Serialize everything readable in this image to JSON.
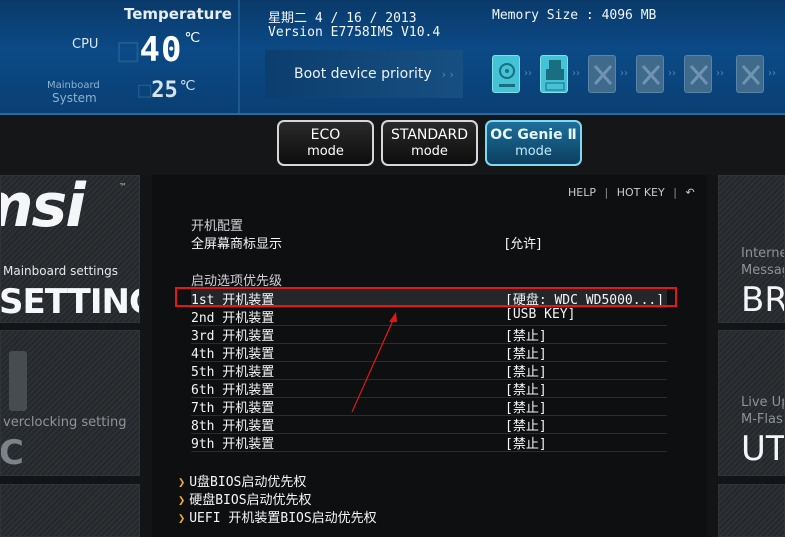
{
  "header": {
    "temperature_title": "Temperature",
    "cpu_label": "CPU",
    "cpu_temp": "40",
    "cpu_temp_ghost": "□",
    "mainboard_label_line1": "Mainboard",
    "mainboard_label_line2": "System",
    "system_temp": "25",
    "system_temp_ghost": "□",
    "degree_unit": "℃",
    "date_line": "星期二  4 / 16 / 2013",
    "version_line": "Version E7758IMS V10.4",
    "memory_line": "Memory Size : 4096 MB",
    "boot_priority_label": "Boot device priority",
    "boot_arrows": "› ›",
    "boot_devices": [
      {
        "icon": "hard-disk-icon",
        "state": "active"
      },
      {
        "icon": "usb-drive-icon",
        "state": "active",
        "label": "USB"
      },
      {
        "icon": "empty-device-icon",
        "state": "inactive"
      },
      {
        "icon": "empty-device-icon",
        "state": "inactive"
      },
      {
        "icon": "empty-device-icon",
        "state": "inactive"
      },
      {
        "icon": "empty-device-icon",
        "state": "inactive"
      }
    ],
    "device_arrow": "››"
  },
  "modes": [
    {
      "line1": "ECO",
      "line2": "mode",
      "active": false
    },
    {
      "line1": "STANDARD",
      "line2": "mode",
      "active": false
    },
    {
      "line1": "OC Genie Ⅱ",
      "line2": "mode",
      "active": true
    }
  ],
  "left_panels": {
    "logo_text": "msi",
    "trademark": "™",
    "settings_sub": "Mainboard settings",
    "settings_title": "SETTINGS",
    "oc_sub": "verclocking setting",
    "oc_title": "C"
  },
  "right_panels": {
    "top_line1": "Interne",
    "top_line2": "Messag",
    "top_big": "BR",
    "bottom_line1": "Live Up",
    "bottom_line2": "M-Flas",
    "bottom_big": "UT"
  },
  "topnav": {
    "help": "HELP",
    "sep": "|",
    "hotkey": "HOT KEY",
    "back_icon_glyph": "↶"
  },
  "boot_config": {
    "section_title": "开机配置",
    "fullscreen_label": "全屏幕商标显示",
    "fullscreen_value": "[允许]",
    "priority_title": "启动选项优先级",
    "devices": [
      {
        "label": "1st 开机装置",
        "value": "[硬盘: WDC WD5000...]"
      },
      {
        "label": "2nd 开机装置",
        "value": "[USB KEY]"
      },
      {
        "label": "3rd 开机装置",
        "value": "[禁止]"
      },
      {
        "label": "4th 开机装置",
        "value": "[禁止]"
      },
      {
        "label": "5th 开机装置",
        "value": "[禁止]"
      },
      {
        "label": "6th 开机装置",
        "value": "[禁止]"
      },
      {
        "label": "7th 开机装置",
        "value": "[禁止]"
      },
      {
        "label": "8th 开机装置",
        "value": "[禁止]"
      },
      {
        "label": "9th 开机装置",
        "value": "[禁止]"
      }
    ],
    "links": [
      "U盘BIOS启动优先权",
      "硬盘BIOS启动优先权",
      "UEFI 开机装置BIOS启动优先权"
    ],
    "link_chevron": "❯"
  },
  "colors": {
    "annotation_red": "#e01818",
    "accent_cyan": "#44c2d6",
    "header_blue": "#0b4a86"
  }
}
